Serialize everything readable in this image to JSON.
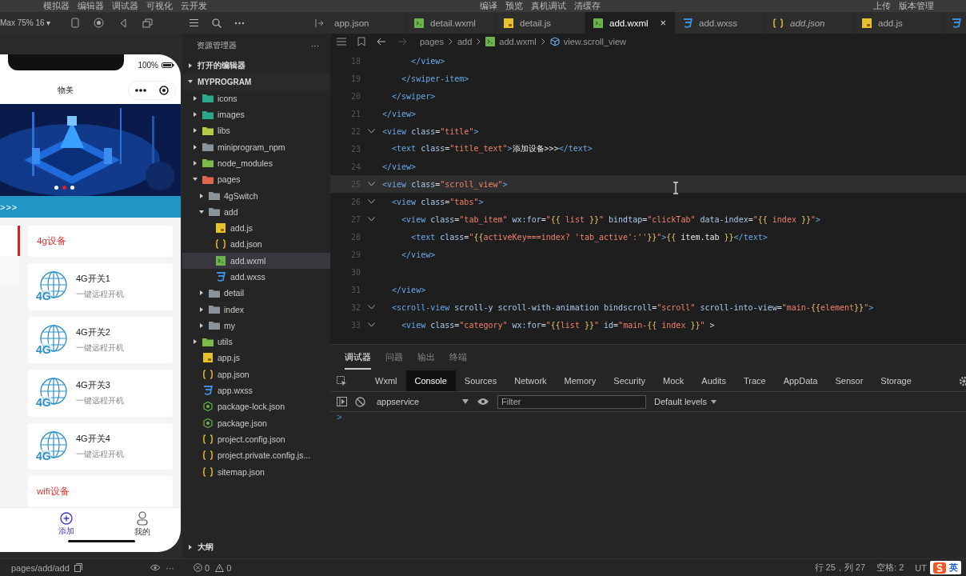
{
  "menu_bar": {
    "left": [
      "模拟器",
      "编辑器",
      "调试器",
      "可视化",
      "云开发"
    ],
    "center": [
      "编译",
      "预览",
      "真机调试",
      "清缓存"
    ],
    "right": [
      "上传",
      "版本管理"
    ]
  },
  "simulator": {
    "device": "Max 75% 16 ▾",
    "battery": "100%",
    "nav_title": "物美",
    "banner": {
      "kind": "picture",
      "dots": [
        {
          "selected": false
        },
        {
          "selected": true
        },
        {
          "selected": false
        }
      ]
    },
    "title_bar": ">>>",
    "side_tabs": [
      {
        "selected": true
      },
      {
        "selected": false
      }
    ],
    "categories": [
      {
        "title": "4g设备",
        "devices": [
          {
            "name": "4G开关1",
            "desc": "一键远程开机",
            "icon_text": "4G"
          },
          {
            "name": "4G开关2",
            "desc": "一键远程开机",
            "icon_text": "4G"
          },
          {
            "name": "4G开关3",
            "desc": "一键远程开机",
            "icon_text": "4G"
          },
          {
            "name": "4G开关4",
            "desc": "一键远程开机",
            "icon_text": "4G"
          }
        ]
      },
      {
        "title": "wifi设备"
      }
    ],
    "tabbar": [
      {
        "label": "添加",
        "kind": "add",
        "selected": true
      },
      {
        "label": "我的",
        "kind": "user",
        "selected": false
      }
    ]
  },
  "explorer": {
    "header": "资源管理器",
    "more": "···",
    "sections": [
      {
        "label": "打开的编辑器",
        "expanded": false
      },
      {
        "label": "MYPROGRAM",
        "expanded": true,
        "items": [
          {
            "name": "icons",
            "kind": "folder",
            "color": "#2aa889",
            "expanded": false,
            "selected": false
          },
          {
            "name": "images",
            "kind": "folder",
            "color": "#2aa889",
            "expanded": false,
            "selected": false
          },
          {
            "name": "libs",
            "kind": "folder",
            "color": "#b5c943",
            "expanded": false,
            "selected": false
          },
          {
            "name": "miniprogram_npm",
            "kind": "folder",
            "color": "#8a9399",
            "expanded": false,
            "selected": false
          },
          {
            "name": "node_modules",
            "kind": "folder",
            "color": "#7cba4a",
            "expanded": false,
            "selected": false
          },
          {
            "name": "pages",
            "kind": "folder",
            "color": "#e0654e",
            "expanded": true,
            "selected": false,
            "children": [
              {
                "name": "4gSwitch",
                "kind": "folder",
                "color": "#8a9399",
                "expanded": false,
                "selected": false
              },
              {
                "name": "add",
                "kind": "folder",
                "color": "#8a9399",
                "expanded": true,
                "selected": false,
                "children": [
                  {
                    "name": "add.js",
                    "kind": "js",
                    "selected": false
                  },
                  {
                    "name": "add.json",
                    "kind": "json",
                    "selected": false
                  },
                  {
                    "name": "add.wxml",
                    "kind": "wxml",
                    "selected": true
                  },
                  {
                    "name": "add.wxss",
                    "kind": "wxss",
                    "selected": false
                  }
                ]
              },
              {
                "name": "detail",
                "kind": "folder",
                "color": "#8a9399",
                "expanded": false,
                "selected": false
              },
              {
                "name": "index",
                "kind": "folder",
                "color": "#8a9399",
                "expanded": false,
                "selected": false
              },
              {
                "name": "my",
                "kind": "folder",
                "color": "#8a9399",
                "expanded": false,
                "selected": false
              }
            ]
          },
          {
            "name": "utils",
            "kind": "folder",
            "color": "#7cba4a",
            "expanded": false,
            "selected": false
          },
          {
            "name": "app.js",
            "kind": "js",
            "selected": false
          },
          {
            "name": "app.json",
            "kind": "json",
            "selected": false
          },
          {
            "name": "app.wxss",
            "kind": "wxss",
            "selected": false
          },
          {
            "name": "package-lock.json",
            "kind": "npm",
            "selected": false
          },
          {
            "name": "package.json",
            "kind": "npm",
            "selected": false
          },
          {
            "name": "project.config.json",
            "kind": "json",
            "selected": false
          },
          {
            "name": "project.private.config.js...",
            "kind": "json",
            "selected": false
          },
          {
            "name": "sitemap.json",
            "kind": "json",
            "selected": false
          }
        ]
      }
    ],
    "outline": {
      "label": "大纲",
      "expanded": false
    }
  },
  "editor": {
    "tabs": [
      {
        "label": "app.json",
        "selected": false,
        "preview": false
      },
      {
        "label": "detail.wxml",
        "kind": "wxml",
        "selected": false,
        "preview": false
      },
      {
        "label": "detail.js",
        "kind": "js",
        "selected": false,
        "preview": false
      },
      {
        "label": "add.wxml",
        "kind": "wxml",
        "selected": true,
        "preview": false,
        "close": "×"
      },
      {
        "label": "add.wxss",
        "kind": "wxss",
        "selected": false,
        "preview": false
      },
      {
        "label": "add.json",
        "kind": "json",
        "selected": false,
        "preview": true
      },
      {
        "label": "add.js",
        "kind": "js",
        "selected": false,
        "preview": false
      },
      {
        "kind": "wxss",
        "selected": false
      }
    ],
    "breadcrumb": [
      {
        "label": "pages"
      },
      {
        "label": "add"
      },
      {
        "label": "add.wxml",
        "kind": "wxml"
      },
      {
        "label": "view.scroll_view",
        "kind": "element"
      }
    ],
    "lines": [
      {
        "number": "18",
        "fold": false,
        "current": false,
        "tokens": [
          {
            "kind": "tag",
            "text": "      </view>"
          }
        ]
      },
      {
        "number": "19",
        "fold": false,
        "current": false,
        "tokens": [
          {
            "kind": "tag",
            "text": "    </swiper-item>"
          }
        ]
      },
      {
        "number": "20",
        "fold": false,
        "current": false,
        "tokens": [
          {
            "kind": "tag",
            "text": "  </swiper>"
          }
        ]
      },
      {
        "number": "21",
        "fold": false,
        "current": false,
        "tokens": [
          {
            "kind": "tag",
            "text": "</view>"
          }
        ]
      },
      {
        "number": "22",
        "fold": true,
        "current": false,
        "tokens": [
          {
            "kind": "tag",
            "text": "<view"
          },
          {
            "kind": "attr",
            "text": " class"
          },
          {
            "kind": "punct",
            "text": "="
          },
          {
            "kind": "str",
            "text": "\"title\""
          },
          {
            "kind": "tag",
            "text": ">"
          }
        ]
      },
      {
        "number": "23",
        "fold": false,
        "current": false,
        "tokens": [
          {
            "kind": "tag",
            "text": "  <text"
          },
          {
            "kind": "attr",
            "text": " class"
          },
          {
            "kind": "punct",
            "text": "="
          },
          {
            "kind": "str",
            "text": "\"title_text\""
          },
          {
            "kind": "tag",
            "text": ">"
          },
          {
            "kind": "text",
            "text": "添加设备>>>"
          },
          {
            "kind": "tag",
            "text": "</text>"
          }
        ]
      },
      {
        "number": "24",
        "fold": false,
        "current": false,
        "tokens": [
          {
            "kind": "tag",
            "text": "</view>"
          }
        ]
      },
      {
        "number": "25",
        "fold": true,
        "current": true,
        "tokens": [
          {
            "kind": "tag",
            "text": "<view"
          },
          {
            "kind": "attr",
            "text": " class"
          },
          {
            "kind": "punct",
            "text": "="
          },
          {
            "kind": "str",
            "text": "\"scroll_view\""
          },
          {
            "kind": "tag",
            "text": ">"
          }
        ]
      },
      {
        "number": "26",
        "fold": true,
        "current": false,
        "tokens": [
          {
            "kind": "tag",
            "text": "  <view"
          },
          {
            "kind": "attr",
            "text": " class"
          },
          {
            "kind": "punct",
            "text": "="
          },
          {
            "kind": "str",
            "text": "\"tabs\""
          },
          {
            "kind": "tag",
            "text": ">"
          }
        ]
      },
      {
        "number": "27",
        "fold": true,
        "current": false,
        "tokens": [
          {
            "kind": "tag",
            "text": "    <view"
          },
          {
            "kind": "attr",
            "text": " class"
          },
          {
            "kind": "punct",
            "text": "="
          },
          {
            "kind": "str",
            "text": "\"tab_item\""
          },
          {
            "kind": "attr",
            "text": " wx:for"
          },
          {
            "kind": "punct",
            "text": "="
          },
          {
            "kind": "str",
            "text": "\""
          },
          {
            "kind": "brace",
            "text": "{{"
          },
          {
            "kind": "var",
            "text": " list "
          },
          {
            "kind": "brace",
            "text": "}}"
          },
          {
            "kind": "str",
            "text": "\""
          },
          {
            "kind": "attr",
            "text": " bindtap"
          },
          {
            "kind": "punct",
            "text": "="
          },
          {
            "kind": "str",
            "text": "\"clickTab\""
          },
          {
            "kind": "attr",
            "text": " data-index"
          },
          {
            "kind": "punct",
            "text": "="
          },
          {
            "kind": "str",
            "text": "\""
          },
          {
            "kind": "brace",
            "text": "{{"
          },
          {
            "kind": "var",
            "text": " index "
          },
          {
            "kind": "brace",
            "text": "}}"
          },
          {
            "kind": "str",
            "text": "\""
          },
          {
            "kind": "tag",
            "text": ">"
          }
        ]
      },
      {
        "number": "28",
        "fold": false,
        "current": false,
        "tokens": [
          {
            "kind": "tag",
            "text": "      <text"
          },
          {
            "kind": "attr",
            "text": " class"
          },
          {
            "kind": "punct",
            "text": "="
          },
          {
            "kind": "str",
            "text": "\""
          },
          {
            "kind": "brace",
            "text": "{{"
          },
          {
            "kind": "var",
            "text": "activeKey===index? 'tab_active':''"
          },
          {
            "kind": "brace",
            "text": "}}"
          },
          {
            "kind": "str",
            "text": "\""
          },
          {
            "kind": "tag",
            "text": ">"
          },
          {
            "kind": "brace",
            "text": "{{"
          },
          {
            "kind": "text",
            "text": " item.tab "
          },
          {
            "kind": "brace",
            "text": "}}"
          },
          {
            "kind": "tag",
            "text": "</text>"
          }
        ]
      },
      {
        "number": "29",
        "fold": false,
        "current": false,
        "tokens": [
          {
            "kind": "tag",
            "text": "    </view>"
          }
        ]
      },
      {
        "number": "30",
        "fold": false,
        "current": false
      },
      {
        "number": "31",
        "fold": false,
        "current": false,
        "tokens": [
          {
            "kind": "tag",
            "text": "  </view>"
          }
        ]
      },
      {
        "number": "32",
        "fold": true,
        "current": false,
        "tokens": [
          {
            "kind": "tag",
            "text": "  <scroll-view"
          },
          {
            "kind": "attr",
            "text": " scroll-y scroll-with-animation bindscroll"
          },
          {
            "kind": "punct",
            "text": "="
          },
          {
            "kind": "str",
            "text": "\"scroll\""
          },
          {
            "kind": "attr",
            "text": " scroll-into-view"
          },
          {
            "kind": "punct",
            "text": "="
          },
          {
            "kind": "str",
            "text": "\"main-"
          },
          {
            "kind": "brace",
            "text": "{{"
          },
          {
            "kind": "var",
            "text": "element"
          },
          {
            "kind": "brace",
            "text": "}}"
          },
          {
            "kind": "str",
            "text": "\""
          },
          {
            "kind": "tag",
            "text": ">"
          }
        ]
      },
      {
        "number": "33",
        "fold": true,
        "current": false,
        "tokens": [
          {
            "kind": "tag",
            "text": "    <view"
          },
          {
            "kind": "attr",
            "text": " class"
          },
          {
            "kind": "punct",
            "text": "="
          },
          {
            "kind": "str",
            "text": "\"category\""
          },
          {
            "kind": "attr",
            "text": " wx:for"
          },
          {
            "kind": "punct",
            "text": "="
          },
          {
            "kind": "str",
            "text": "\""
          },
          {
            "kind": "brace",
            "text": "{{"
          },
          {
            "kind": "var",
            "text": "list "
          },
          {
            "kind": "brace",
            "text": "}}"
          },
          {
            "kind": "str",
            "text": "\""
          },
          {
            "kind": "attr",
            "text": " id"
          },
          {
            "kind": "punct",
            "text": "="
          },
          {
            "kind": "str",
            "text": "\"main-"
          },
          {
            "kind": "brace",
            "text": "{{"
          },
          {
            "kind": "var",
            "text": " index "
          },
          {
            "kind": "brace",
            "text": "}}"
          },
          {
            "kind": "str",
            "text": "\""
          },
          {
            "kind": "punct",
            "text": " >"
          }
        ]
      }
    ]
  },
  "debugger": {
    "tabs": [
      {
        "label": "调试器",
        "selected": true
      },
      {
        "label": "问题",
        "selected": false
      },
      {
        "label": "输出",
        "selected": false
      },
      {
        "label": "终端",
        "selected": false
      }
    ],
    "tools": [
      {
        "label": "Wxml",
        "selected": false
      },
      {
        "label": "Console",
        "selected": true
      },
      {
        "label": "Sources",
        "selected": false
      },
      {
        "label": "Network",
        "selected": false
      },
      {
        "label": "Memory",
        "selected": false
      },
      {
        "label": "Security",
        "selected": false
      },
      {
        "label": "Mock",
        "selected": false
      },
      {
        "label": "Audits",
        "selected": false
      },
      {
        "label": "Trace",
        "selected": false
      },
      {
        "label": "AppData",
        "selected": false
      },
      {
        "label": "Sensor",
        "selected": false
      },
      {
        "label": "Storage",
        "selected": false
      }
    ],
    "context": "appservice",
    "filter_placeholder": "Filter",
    "levels": "Default levels",
    "prompt": ">"
  },
  "status_bar": {
    "path": "pages/add/add",
    "more": "···",
    "errors": "0",
    "warnings": "0",
    "cursor": "行 25，列 27",
    "indent": "空格: 2",
    "encoding": "UT",
    "ime": "英"
  }
}
